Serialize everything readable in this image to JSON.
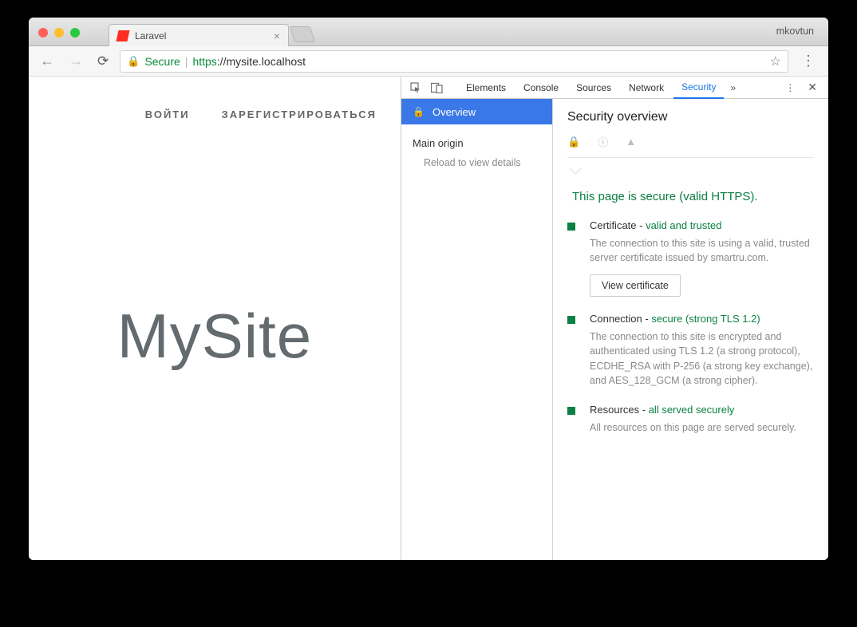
{
  "chrome": {
    "profile": "mkovtun",
    "tab_title": "Laravel",
    "back": "←",
    "forward": "→",
    "reload": "⟳",
    "secure_label": "Secure",
    "url_scheme": "https",
    "url_rest": "://mysite.localhost",
    "star": "☆",
    "kebab": "⋮"
  },
  "page": {
    "nav_login": "ВОЙТИ",
    "nav_register": "ЗАРЕГИСТРИРОВАТЬСЯ",
    "brand": "MySite"
  },
  "devtools": {
    "tabs": {
      "elements": "Elements",
      "console": "Console",
      "sources": "Sources",
      "network": "Network",
      "security": "Security"
    },
    "more": "»",
    "menu": "⋮",
    "close": "✕",
    "sidebar": {
      "overview": "Overview",
      "main_origin": "Main origin",
      "reload_hint": "Reload to view details"
    },
    "panel": {
      "title": "Security overview",
      "headline": "This page is secure (valid HTTPS).",
      "cert_head": "Certificate - ",
      "cert_status": "valid and trusted",
      "cert_desc": "The connection to this site is using a valid, trusted server certificate issued by smartru.com.",
      "view_cert": "View certificate",
      "conn_head": "Connection - ",
      "conn_status": "secure (strong TLS 1.2)",
      "conn_desc": "The connection to this site is encrypted and authenticated using TLS 1.2 (a strong protocol), ECDHE_RSA with P-256 (a strong key exchange), and AES_128_GCM (a strong cipher).",
      "res_head": "Resources - ",
      "res_status": "all served securely",
      "res_desc": "All resources on this page are served securely."
    }
  }
}
